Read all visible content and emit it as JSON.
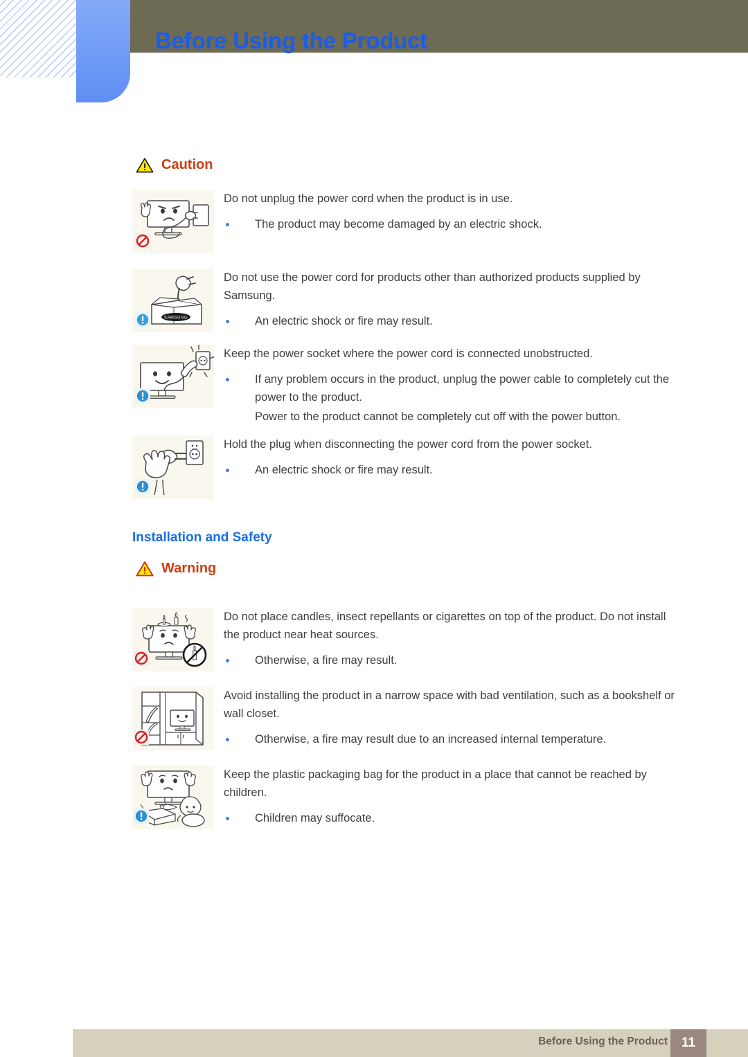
{
  "header": {
    "title": "Before Using the Product"
  },
  "footer": {
    "label": "Before Using the Product",
    "page_number": "11"
  },
  "colors": {
    "title_blue": "#1a5ceb",
    "heading_blue": "#1a6fe0",
    "alert_orange": "#cc3f12",
    "bullet_blue": "#3f7fd8",
    "olive_bar": "#6e6b55",
    "blue_tab": "#6f9cf6",
    "footer_bar": "#d6d1bd",
    "footer_page_box": "#9a877f",
    "illustration_bg": "#faf7ee",
    "warning_yellow": "#ffe800",
    "prohibit_red": "#d4232a",
    "info_blue": "#3a9fd8"
  },
  "sections": [
    {
      "id": "caution-section",
      "alert_label": "Caution",
      "alert_icon": "warning-triangle-icon",
      "triangle_outline": "#1a1a1a",
      "rules": [
        {
          "icon_name": "monitor-unplug-prohibited-icon",
          "badge": "prohibition-badge",
          "lead": "Do not unplug the power cord when the product is in use.",
          "bullets": [
            {
              "text": "The product may become damaged by an electric shock.",
              "dot": true
            }
          ]
        },
        {
          "icon_name": "power-plug-samsung-box-icon",
          "badge": "mandatory-badge",
          "lead": "Do not use the power cord for products other than authorized products supplied by Samsung.",
          "bullets": [
            {
              "text": "An electric shock or fire may result.",
              "dot": true
            }
          ]
        },
        {
          "icon_name": "monitor-power-socket-icon",
          "badge": "mandatory-badge",
          "lead": "Keep the power socket where the power cord is connected unobstructed.",
          "bullets": [
            {
              "text": "If any problem occurs in the product, unplug the power cable to completely cut the power to the product.",
              "dot": true
            },
            {
              "text": "Power to the product cannot be completely cut off with the power button.",
              "dot": false
            }
          ]
        },
        {
          "icon_name": "hand-holding-plug-socket-icon",
          "badge": "mandatory-badge",
          "lead": "Hold the plug when disconnecting the power cord from the power socket.",
          "bullets": [
            {
              "text": "An electric shock or fire may result.",
              "dot": true
            }
          ]
        }
      ]
    },
    {
      "id": "installation-section",
      "section_title": "Installation and Safety",
      "alert_label": "Warning",
      "alert_icon": "warning-triangle-icon",
      "triangle_outline": "#e02020",
      "rules": [
        {
          "icon_name": "monitor-candles-prohibited-icon",
          "badge": "prohibition-badge",
          "lead": "Do not place candles, insect repellants or cigarettes on top of the product. Do not install the product near heat sources.",
          "bullets": [
            {
              "text": "Otherwise, a fire may result.",
              "dot": true
            }
          ]
        },
        {
          "icon_name": "monitor-in-bookshelf-prohibited-icon",
          "badge": "prohibition-badge",
          "lead": "Avoid installing the product in a narrow space with bad ventilation, such as a bookshelf or wall closet.",
          "bullets": [
            {
              "text": "Otherwise, a fire may result due to an increased internal temperature.",
              "dot": true
            }
          ]
        },
        {
          "icon_name": "child-plastic-bag-icon",
          "badge": "mandatory-badge",
          "lead": "Keep the plastic packaging bag for the product in a place that cannot be reached by children.",
          "bullets": [
            {
              "text": "Children may suffocate.",
              "dot": true
            }
          ]
        }
      ]
    }
  ]
}
